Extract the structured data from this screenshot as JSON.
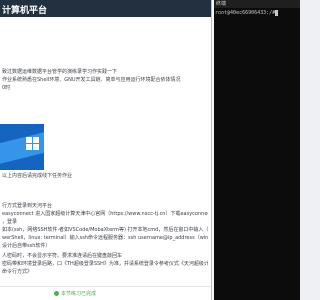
{
  "left_panel": {
    "header_title": "计算机平台",
    "paragraphs": [
      "致过数据运维数据平台管学的演练录学习作实践一下",
      "作业系统熟悉在Shell环境、GNU开发工具链、简单与应用运行环境配合依体情况",
      "0时",
      "以上内容后请完成线下任务作业",
      "行方式登录到天河平台",
      "easyconnect 进入国家超级计算天津中心官网（https://www.nscc-tj.cn）下载easyconnect",
      "，登录",
      "如本(ssh，网络SSH软件·者如VSCode/MobaXterm等) 打开本地cmd，然后在窗口中输入（wind",
      "werShell，linux: terminal）输入ssh命令远程服务器：ssh username@ip_address（win10",
      "设计后自带ssh软件）",
      "人密码时，不会显示字符。要求准连请后在键盘敲回车",
      "密码带和环境登录后路，口《TH超级登录SSH》为准，并请系统登录令参考仪式《天河超级计算",
      "命令行方式》"
    ],
    "status_text": "本节练习已完成"
  },
  "terminal": {
    "title": "终端",
    "line": "root@40ec66906433:/#"
  }
}
